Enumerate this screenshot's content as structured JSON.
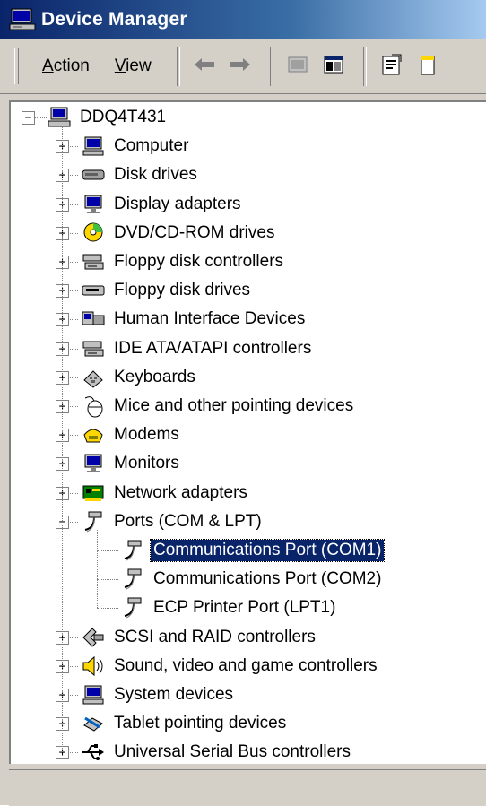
{
  "window": {
    "title": "Device Manager"
  },
  "toolbar": {
    "menu_action": "Action",
    "menu_view": "View",
    "buttons": [
      "back-icon",
      "forward-icon",
      "up-icon",
      "show-hide-tree-icon",
      "properties-icon",
      "help-icon"
    ]
  },
  "tree": {
    "root_label": "DDQ4T431",
    "categories": [
      {
        "label": "Computer",
        "icon": "computer-icon",
        "expanded": false
      },
      {
        "label": "Disk drives",
        "icon": "disk-drive-icon",
        "expanded": false
      },
      {
        "label": "Display adapters",
        "icon": "display-adapter-icon",
        "expanded": false
      },
      {
        "label": "DVD/CD-ROM drives",
        "icon": "cdrom-icon",
        "expanded": false
      },
      {
        "label": "Floppy disk controllers",
        "icon": "controller-icon",
        "expanded": false
      },
      {
        "label": "Floppy disk drives",
        "icon": "floppy-drive-icon",
        "expanded": false
      },
      {
        "label": "Human Interface Devices",
        "icon": "hid-icon",
        "expanded": false
      },
      {
        "label": "IDE ATA/ATAPI controllers",
        "icon": "controller-icon",
        "expanded": false
      },
      {
        "label": "Keyboards",
        "icon": "keyboard-icon",
        "expanded": false
      },
      {
        "label": "Mice and other pointing devices",
        "icon": "mouse-icon",
        "expanded": false
      },
      {
        "label": "Modems",
        "icon": "modem-icon",
        "expanded": false
      },
      {
        "label": "Monitors",
        "icon": "monitor-icon",
        "expanded": false
      },
      {
        "label": "Network adapters",
        "icon": "network-adapter-icon",
        "expanded": false
      },
      {
        "label": "Ports (COM & LPT)",
        "icon": "port-icon",
        "expanded": true,
        "children": [
          {
            "label": "Communications Port (COM1)",
            "icon": "port-icon",
            "selected": true
          },
          {
            "label": "Communications Port (COM2)",
            "icon": "port-icon",
            "selected": false
          },
          {
            "label": "ECP Printer Port (LPT1)",
            "icon": "port-icon",
            "selected": false
          }
        ]
      },
      {
        "label": "SCSI and RAID controllers",
        "icon": "scsi-icon",
        "expanded": false
      },
      {
        "label": "Sound, video and game controllers",
        "icon": "sound-icon",
        "expanded": false
      },
      {
        "label": "System devices",
        "icon": "computer-icon",
        "expanded": false
      },
      {
        "label": "Tablet pointing devices",
        "icon": "tablet-icon",
        "expanded": false
      },
      {
        "label": "Universal Serial Bus controllers",
        "icon": "usb-icon",
        "expanded": false
      }
    ]
  },
  "statusbar": {
    "text": ""
  }
}
